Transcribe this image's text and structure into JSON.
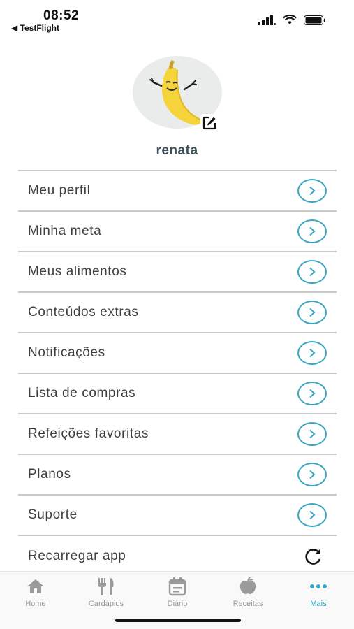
{
  "status": {
    "time": "08:52",
    "back_app": "◀ TestFlight"
  },
  "profile": {
    "username": "renata",
    "avatar_icon": "banana-mascot",
    "edit_icon": "edit-icon"
  },
  "menu": {
    "items": [
      {
        "label": "Meu perfil"
      },
      {
        "label": "Minha meta"
      },
      {
        "label": "Meus alimentos"
      },
      {
        "label": "Conteúdos extras"
      },
      {
        "label": "Notificações"
      },
      {
        "label": "Lista de compras"
      },
      {
        "label": "Refeições favoritas"
      },
      {
        "label": "Planos"
      },
      {
        "label": "Suporte"
      },
      {
        "label": "Recarregar app"
      }
    ]
  },
  "tabbar": {
    "tabs": [
      {
        "label": "Home",
        "icon": "home-icon"
      },
      {
        "label": "Cardápios",
        "icon": "utensils-icon"
      },
      {
        "label": "Diário",
        "icon": "calendar-icon"
      },
      {
        "label": "Receitas",
        "icon": "apple-icon"
      },
      {
        "label": "Mais",
        "icon": "more-icon"
      }
    ],
    "active": "Mais"
  },
  "colors": {
    "accent": "#3aa6bf",
    "text": "#3f3f3f",
    "username": "#3d5159",
    "inactive_tab": "#9a9a9a",
    "active_tab": "#35a9c9"
  }
}
